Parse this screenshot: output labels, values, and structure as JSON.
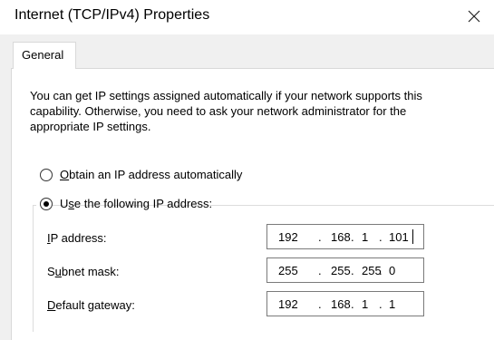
{
  "window": {
    "title": "Internet (TCP/IPv4) Properties",
    "close_glyph": "×"
  },
  "tabs": [
    {
      "label": "General"
    }
  ],
  "general": {
    "description": "You can get IP settings assigned automatically if your network supports this capability. Otherwise, you need to ask your network administrator for the appropriate IP settings.",
    "options": [
      {
        "mnemonic": "O",
        "rest": "btain an IP address automatically",
        "checked": false
      },
      {
        "prefix": "U",
        "mnemonic": "s",
        "rest": "e the following IP address:",
        "checked": true
      }
    ],
    "fields": [
      {
        "mnemonic": "I",
        "rest": "P address:",
        "octets": [
          "192",
          "168",
          "1",
          "101"
        ]
      },
      {
        "prefix": "S",
        "mnemonic": "u",
        "rest": "bnet mask:",
        "octets": [
          "255",
          "255",
          "255",
          "0"
        ]
      },
      {
        "mnemonic": "D",
        "rest": "efault gateway:",
        "octets": [
          "192",
          "168",
          "1",
          "1"
        ]
      }
    ],
    "separator": "."
  }
}
